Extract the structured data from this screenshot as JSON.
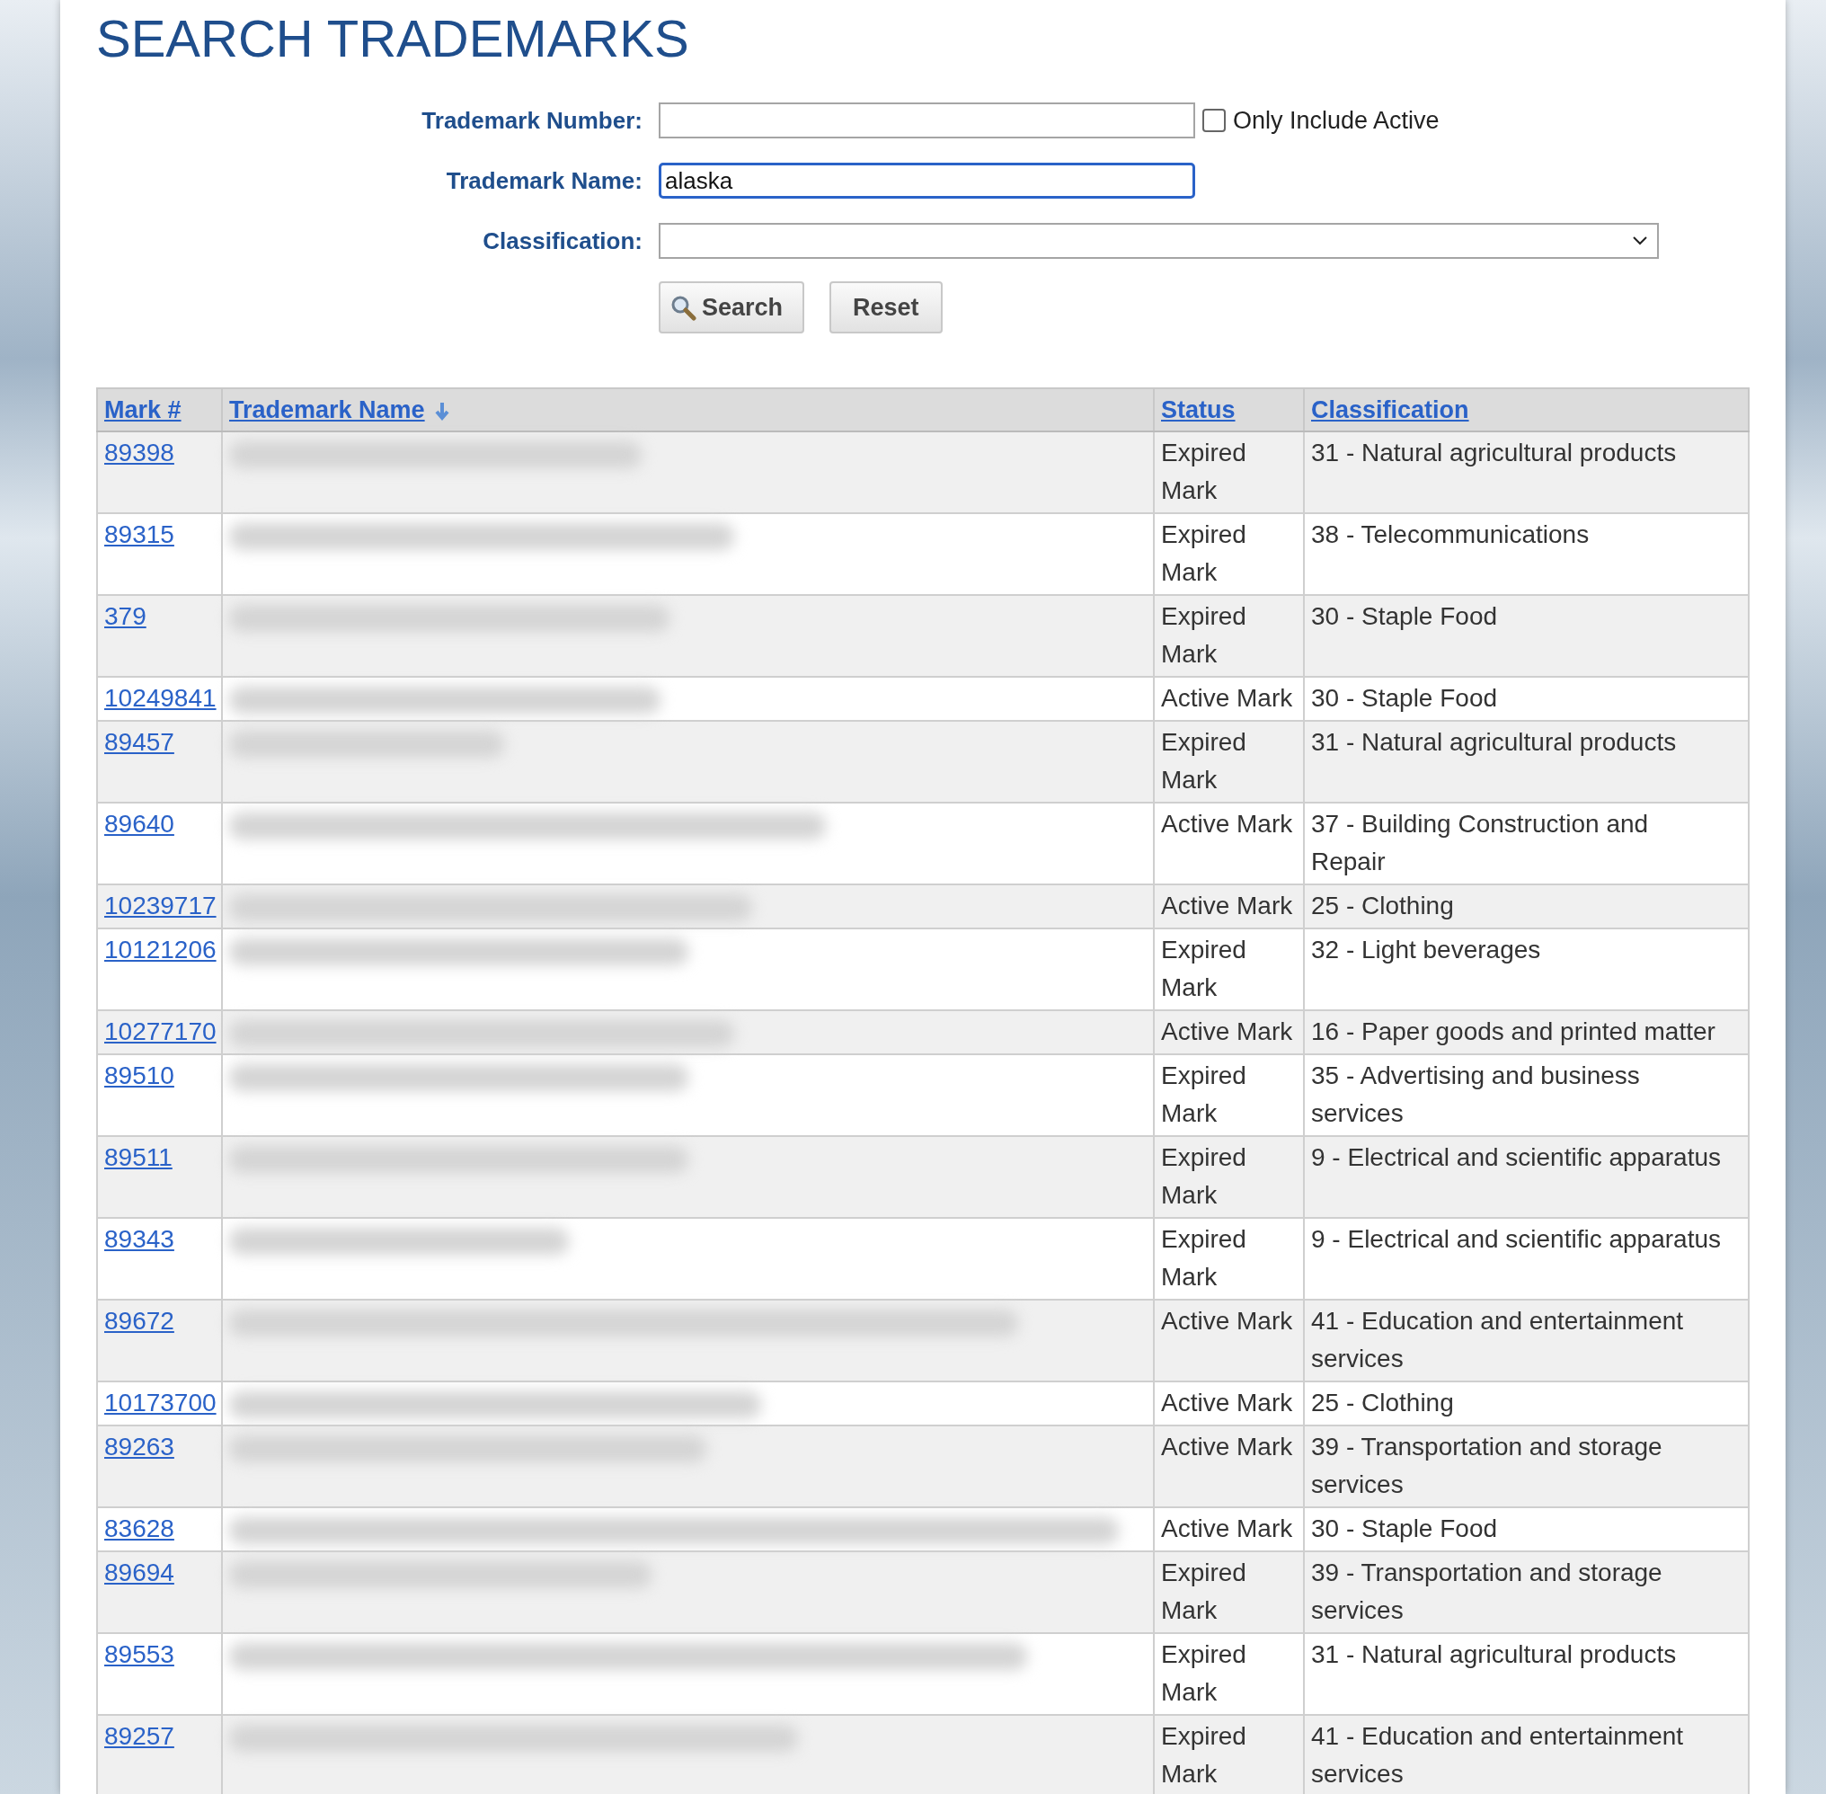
{
  "title": "SEARCH TRADEMARKS",
  "form": {
    "number": {
      "label": "Trademark Number:"
    },
    "active_only": {
      "label": "Only Include Active",
      "checked": false
    },
    "name": {
      "label": "Trademark Name:",
      "value": "alaska",
      "focused": true
    },
    "classification": {
      "label": "Classification:"
    },
    "buttons": [
      {
        "kind": "search",
        "label": "Search"
      },
      {
        "kind": "reset",
        "label": "Reset"
      }
    ]
  },
  "table": {
    "columns": [
      {
        "label": "Mark #",
        "sorted": false
      },
      {
        "label": "Trademark Name",
        "sorted": true
      },
      {
        "label": "Status",
        "sorted": false
      },
      {
        "label": "Classification",
        "sorted": false
      }
    ],
    "rows": [
      {
        "mark": "89398",
        "status": "Expired Mark",
        "classification": "31 - Natural agricultural products"
      },
      {
        "mark": "89315",
        "status": "Expired Mark",
        "classification": "38 - Telecommunications"
      },
      {
        "mark": "379",
        "status": "Expired Mark",
        "classification": "30 - Staple Food"
      },
      {
        "mark": "10249841",
        "status": "Active Mark",
        "classification": "30 - Staple Food"
      },
      {
        "mark": "89457",
        "status": "Expired Mark",
        "classification": "31 - Natural agricultural products"
      },
      {
        "mark": "89640",
        "status": "Active Mark",
        "classification": "37 - Building Construction and Repair"
      },
      {
        "mark": "10239717",
        "status": "Active Mark",
        "classification": "25 - Clothing"
      },
      {
        "mark": "10121206",
        "status": "Expired Mark",
        "classification": "32 - Light beverages"
      },
      {
        "mark": "10277170",
        "status": "Active Mark",
        "classification": "16 - Paper goods and printed matter"
      },
      {
        "mark": "89510",
        "status": "Expired Mark",
        "classification": "35 - Advertising and business services"
      },
      {
        "mark": "89511",
        "status": "Expired Mark",
        "classification": "9 - Electrical and scientific apparatus"
      },
      {
        "mark": "89343",
        "status": "Expired Mark",
        "classification": "9 - Electrical and scientific apparatus"
      },
      {
        "mark": "89672",
        "status": "Active Mark",
        "classification": "41 - Education and entertainment services"
      },
      {
        "mark": "10173700",
        "status": "Active Mark",
        "classification": "25 - Clothing"
      },
      {
        "mark": "89263",
        "status": "Active Mark",
        "classification": "39 - Transportation and storage services"
      },
      {
        "mark": "83628",
        "status": "Active Mark",
        "classification": "30 - Staple Food"
      },
      {
        "mark": "89694",
        "status": "Expired Mark",
        "classification": "39 - Transportation and storage services"
      },
      {
        "mark": "89553",
        "status": "Expired Mark",
        "classification": "31 - Natural agricultural products"
      },
      {
        "mark": "89257",
        "status": "Expired Mark",
        "classification": "41 - Education and entertainment services"
      }
    ]
  }
}
